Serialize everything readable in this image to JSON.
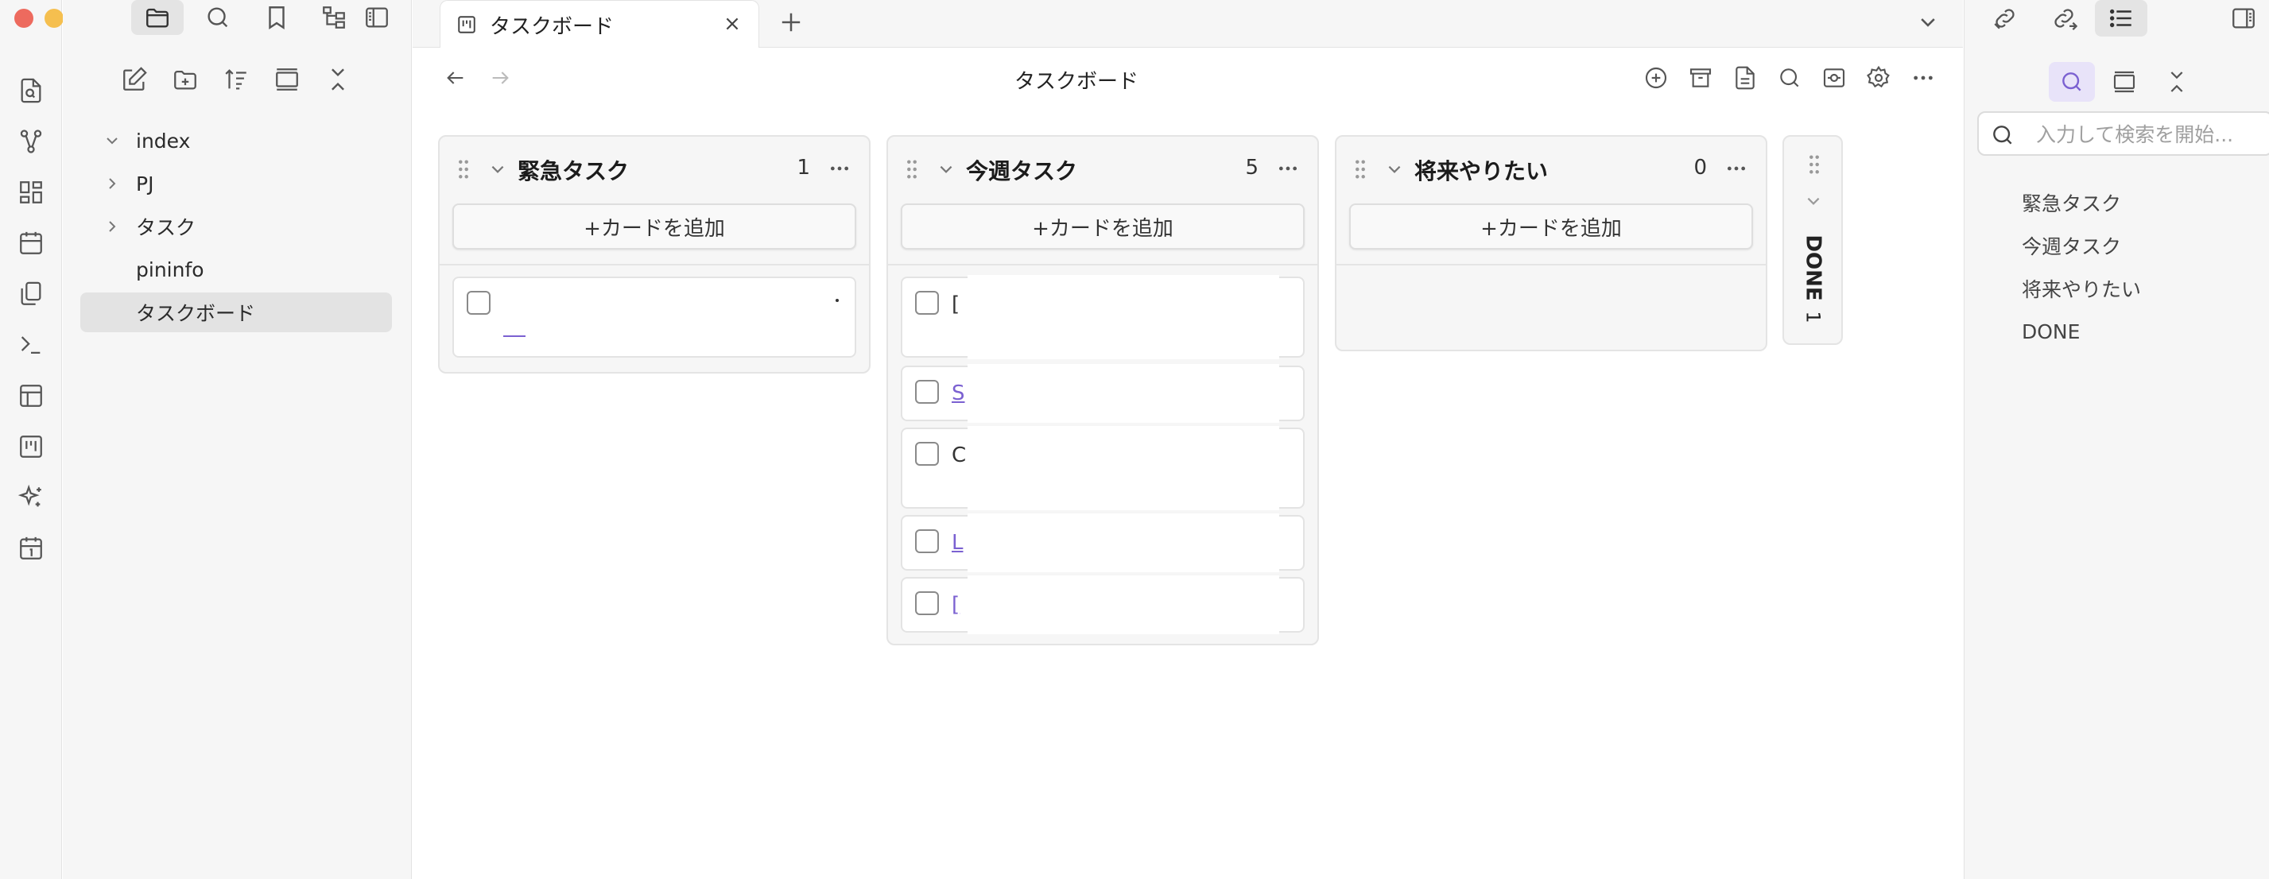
{
  "tab": {
    "label": "タスクボード"
  },
  "view": {
    "title": "タスクボード"
  },
  "explorer": {
    "tree": [
      {
        "label": "index",
        "expanded": true,
        "has_children": true
      },
      {
        "label": "PJ",
        "expanded": false,
        "has_children": true
      },
      {
        "label": "タスク",
        "expanded": false,
        "has_children": true
      },
      {
        "label": "pininfo",
        "expanded": false,
        "has_children": false
      },
      {
        "label": "タスクボード",
        "expanded": false,
        "has_children": false,
        "active": true
      }
    ]
  },
  "board": {
    "add_card_label": "+カードを追加",
    "lanes": [
      {
        "title": "緊急タスク",
        "count": "1",
        "cards": [
          {
            "prefix": "",
            "kind": "text-link"
          }
        ]
      },
      {
        "title": "今週タスク",
        "count": "5",
        "cards": [
          {
            "prefix": "[",
            "kind": "text"
          },
          {
            "prefix": "S",
            "kind": "link"
          },
          {
            "prefix": "C",
            "kind": "text"
          },
          {
            "prefix": "L",
            "kind": "link"
          },
          {
            "prefix": "[",
            "kind": "link"
          }
        ]
      },
      {
        "title": "将来やりたい",
        "count": "0",
        "cards": []
      }
    ],
    "collapsed_lane": {
      "title": "DONE",
      "count": "1"
    }
  },
  "right_sidebar": {
    "search_placeholder": "入力して検索を開始...",
    "outline": [
      "緊急タスク",
      "今週タスク",
      "将来やりたい",
      "DONE"
    ]
  },
  "colors": {
    "accent": "#7b61d1",
    "close": "#ed6a5e",
    "minimize": "#f5bf4f",
    "maximize": "#61c554"
  }
}
